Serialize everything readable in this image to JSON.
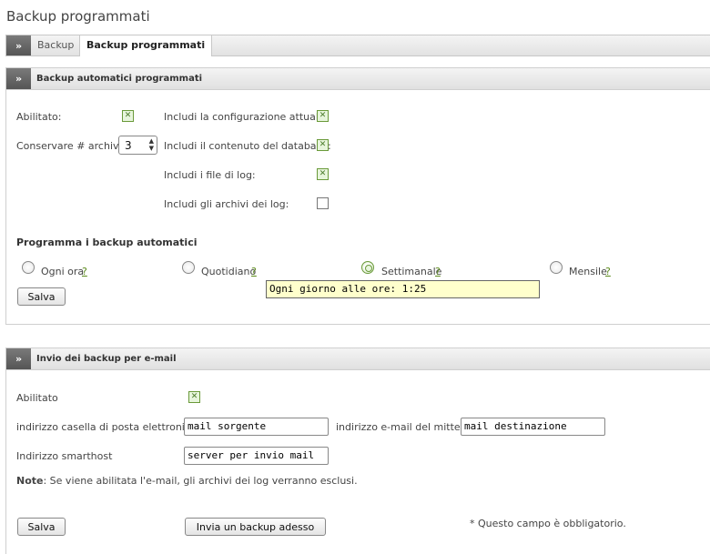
{
  "page_title": "Backup programmati",
  "tabs": {
    "chevron": "»",
    "items": [
      {
        "label": "Backup"
      },
      {
        "label": "Backup programmati"
      }
    ]
  },
  "section_auto": {
    "title": "Backup automatici programmati",
    "enabled_label": "Abilitato:",
    "keep_label": "Conservare # archivi:",
    "keep_value": "3",
    "include_config_label": "Includi la configurazione attuale:",
    "include_db_label": "Includi il contenuto del database:",
    "include_logs_label": "Includi i file di log:",
    "include_log_archives_label": "Includi gli archivi dei log:",
    "schedule_heading": "Programma i backup automatici",
    "schedule_options": [
      {
        "label": "Ogni ora",
        "help": "?"
      },
      {
        "label": "Quotidiano",
        "help": "?"
      },
      {
        "label": "Settimanale",
        "help": "?"
      },
      {
        "label": "Mensile",
        "help": "?"
      }
    ],
    "tooltip": "Ogni giorno alle ore: 1:25",
    "save_label": "Salva"
  },
  "section_email": {
    "title": "Invio dei backup per e-mail",
    "enabled_label": "Abilitato",
    "mailbox_label": "indirizzo casella di posta elettronica *",
    "mailbox_value": "mail sorgente",
    "sender_label": "indirizzo e-mail del mittente",
    "sender_value": "mail destinazione",
    "smarthost_label": "Indirizzo smarthost",
    "smarthost_value": "server per invio mail",
    "note_bold": "Note",
    "note_text": ": Se viene abilitata l'e-mail, gli archivi dei log verranno esclusi.",
    "save_label": "Salva",
    "send_now_label": "Invia un backup adesso",
    "required_note": "* Questo campo è obbligatorio."
  }
}
